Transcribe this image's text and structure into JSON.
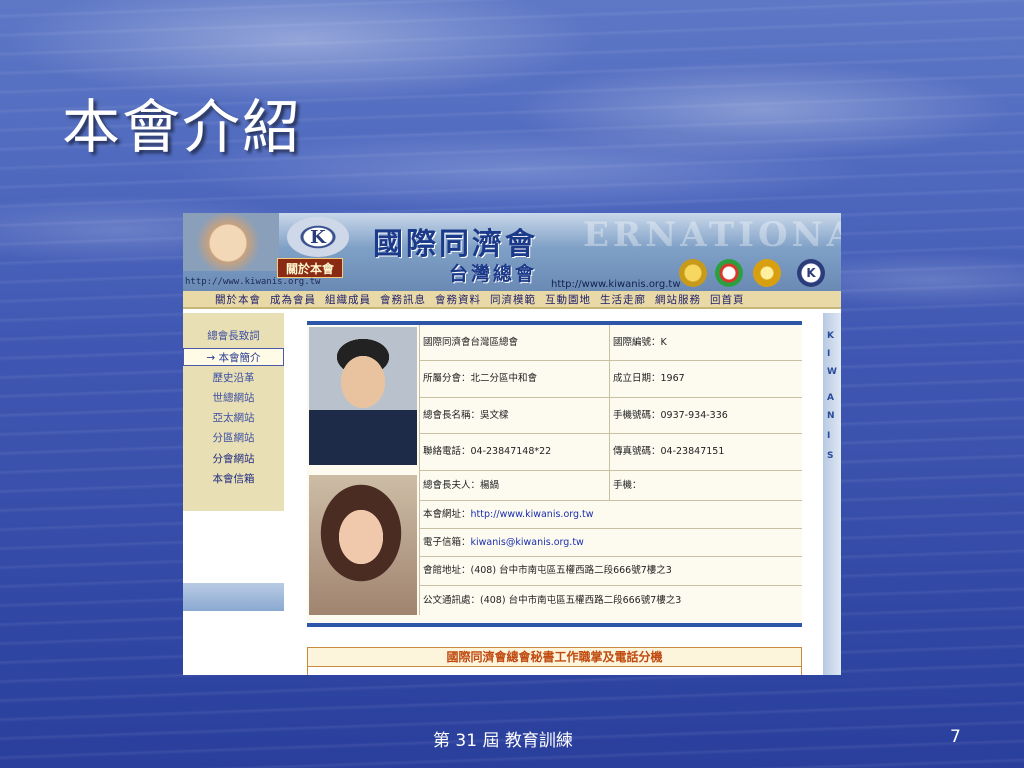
{
  "slide": {
    "title": "本會介紹",
    "footer_text": "第 31 屆 教育訓練",
    "page_number": "7"
  },
  "banner": {
    "section_label": "關於本會",
    "url_left": "http://www.kiwanis.org.tw",
    "title": "國際同濟會",
    "subtitle": "台灣總會",
    "url_right": "http://www.kiwanis.org.tw",
    "logo_letter": "K",
    "watermark": "ERNATIONAL"
  },
  "nav": {
    "items": [
      "關於本會",
      "成為會員",
      "組織成員",
      "會務訊息",
      "會務資料",
      "同濟模範",
      "互動園地",
      "生活走廊",
      "網站服務",
      "回首頁"
    ]
  },
  "sidebar": {
    "items": [
      "總會長致詞",
      "→ 本會簡介",
      "歷史沿革",
      "世總網站",
      "亞太網站",
      "分區網站",
      "分會網站",
      "本會信箱"
    ]
  },
  "strip": {
    "letters": [
      "K",
      "I",
      "W",
      "A",
      "N",
      "I",
      "S"
    ]
  },
  "info": {
    "org_name": "國際同濟會台灣區總會",
    "intl_no": "國際編號：K",
    "district": "所屬分會：北二分區中和會",
    "founded": "成立日期：1967",
    "president": "總會長名稱：吳文樑",
    "mobile": "手機號碼：0937-934-336",
    "phone": "聯絡電話：04-23847148*22",
    "fax": "傳真號碼：04-23847151",
    "spouse": "總會長夫人：楊緺",
    "spouse_mobile": "手機：",
    "website_label": "本會網址：",
    "website": "http://www.kiwanis.org.tw",
    "email_label": "電子信箱：",
    "email": "kiwanis@kiwanis.org.tw",
    "address": "會館地址：(408) 台中市南屯區五權西路二段666號7樓之3",
    "mail_address": "公文通訊處：(408) 台中市南屯區五權西路二段666號7樓之3"
  },
  "secretary_heading": "國際同濟會總會秘書工作職掌及電話分機"
}
